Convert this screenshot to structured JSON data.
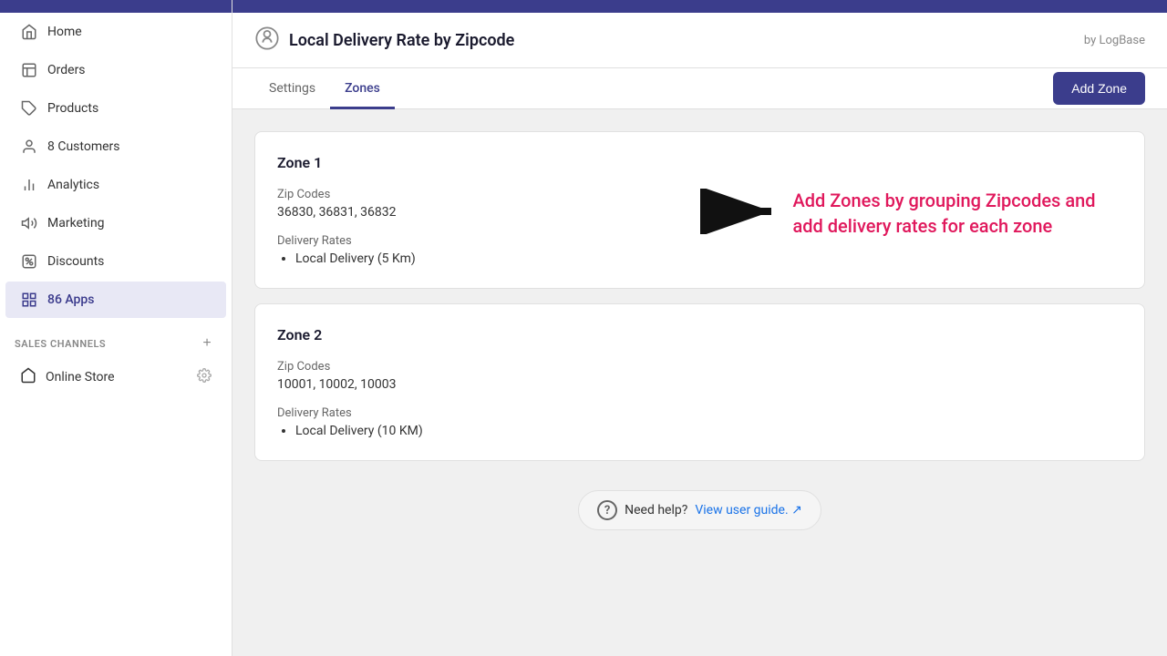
{
  "topbar": {
    "color": "#3b3d8c"
  },
  "sidebar": {
    "items": [
      {
        "id": "home",
        "label": "Home",
        "icon": "home"
      },
      {
        "id": "orders",
        "label": "Orders",
        "icon": "orders"
      },
      {
        "id": "products",
        "label": "Products",
        "icon": "products"
      },
      {
        "id": "customers",
        "label": "8 Customers",
        "icon": "customers"
      },
      {
        "id": "analytics",
        "label": "Analytics",
        "icon": "analytics"
      },
      {
        "id": "marketing",
        "label": "Marketing",
        "icon": "marketing"
      },
      {
        "id": "discounts",
        "label": "Discounts",
        "icon": "discounts"
      },
      {
        "id": "apps",
        "label": "86 Apps",
        "icon": "apps",
        "active": true
      }
    ],
    "sales_channels_label": "SALES CHANNELS",
    "online_store_label": "Online Store"
  },
  "page": {
    "title": "Local Delivery Rate by Zipcode",
    "author": "by LogBase",
    "tabs": [
      {
        "id": "settings",
        "label": "Settings",
        "active": false
      },
      {
        "id": "zones",
        "label": "Zones",
        "active": true
      }
    ],
    "add_zone_button": "Add Zone"
  },
  "zones": [
    {
      "id": "zone1",
      "title": "Zone 1",
      "zip_codes_label": "Zip Codes",
      "zip_codes_value": "36830, 36831, 36832",
      "delivery_rates_label": "Delivery Rates",
      "delivery_rates": [
        "Local Delivery (5 Km)"
      ],
      "show_hint": true,
      "hint_text": "Add Zones by grouping Zipcodes and add delivery rates for each zone"
    },
    {
      "id": "zone2",
      "title": "Zone 2",
      "zip_codes_label": "Zip Codes",
      "zip_codes_value": "10001, 10002, 10003",
      "delivery_rates_label": "Delivery Rates",
      "delivery_rates": [
        "Local Delivery (10 KM)"
      ],
      "show_hint": false
    }
  ],
  "help": {
    "text": "Need help?",
    "link_text": "View user guide.",
    "link_icon": "↗"
  }
}
